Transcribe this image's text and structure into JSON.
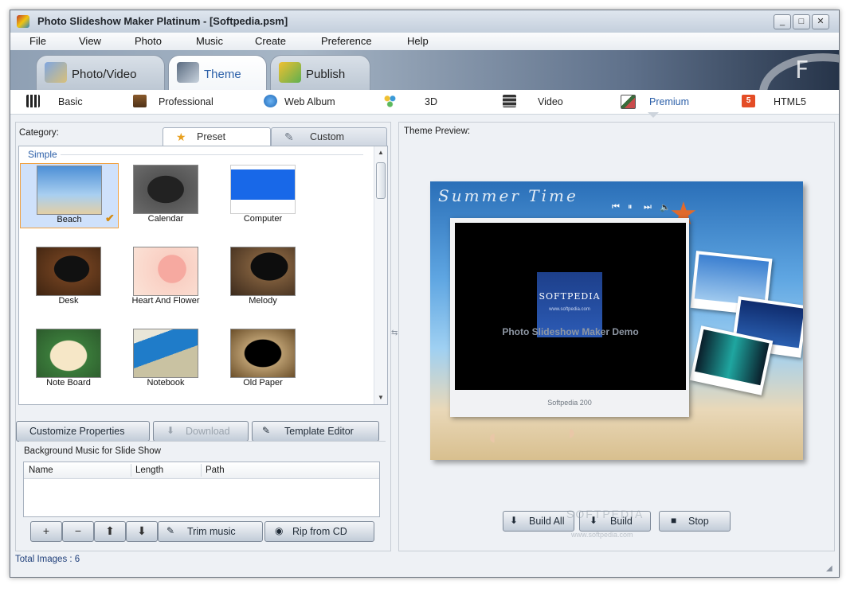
{
  "window": {
    "title": "Photo Slideshow Maker Platinum - [Softpedia.psm]",
    "minimize": "_",
    "maximize": "□",
    "close": "✕"
  },
  "menu": [
    "File",
    "View",
    "Photo",
    "Music",
    "Create",
    "Preference",
    "Help"
  ],
  "main_tabs": [
    {
      "label": "Photo/Video",
      "active": false
    },
    {
      "label": "Theme",
      "active": true
    },
    {
      "label": "Publish",
      "active": false
    }
  ],
  "sub_tabs": [
    {
      "label": "Basic",
      "active": false
    },
    {
      "label": "Professional",
      "active": false
    },
    {
      "label": "Web Album",
      "active": false
    },
    {
      "label": "3D",
      "active": false
    },
    {
      "label": "Video",
      "active": false
    },
    {
      "label": "Premium",
      "active": true
    },
    {
      "label": "HTML5",
      "active": false
    }
  ],
  "left": {
    "category_label": "Category:",
    "tabs": [
      {
        "label": "Preset",
        "active": true
      },
      {
        "label": "Custom",
        "active": false
      }
    ],
    "group": "Simple",
    "themes": [
      {
        "label": "Beach",
        "selected": true
      },
      {
        "label": "Calendar",
        "selected": false
      },
      {
        "label": "Computer",
        "selected": false
      },
      {
        "label": "Desk",
        "selected": false
      },
      {
        "label": "Heart And Flower",
        "selected": false
      },
      {
        "label": "Melody",
        "selected": false
      },
      {
        "label": "Note Board",
        "selected": false
      },
      {
        "label": "Notebook",
        "selected": false
      },
      {
        "label": "Old Paper",
        "selected": false
      }
    ],
    "buttons": {
      "customize": "Customize Properties",
      "download": "Download",
      "template_editor": "Template Editor"
    },
    "bgm": {
      "title": "Background Music for Slide Show",
      "columns": [
        "Name",
        "Length",
        "Path"
      ],
      "rows": [],
      "trim": "Trim music",
      "rip": "Rip from CD"
    }
  },
  "preview": {
    "label": "Theme Preview:",
    "script_text": "Summer Time",
    "logo": "SOFTPEDIA",
    "logo_sub": "www.softpedia.com",
    "demo_text": "Photo Slideshow Maker Demo",
    "caption": "Softpedia 200",
    "buttons": {
      "build_all": "Build All",
      "build": "Build",
      "stop": "Stop"
    },
    "watermark": "SOFTPEDIA",
    "watermark_url": "www.softpedia.com"
  },
  "status": {
    "text": "Total Images : 6"
  },
  "colors": {
    "accent": "#2b5fa8",
    "selection": "#cfe1fb"
  }
}
